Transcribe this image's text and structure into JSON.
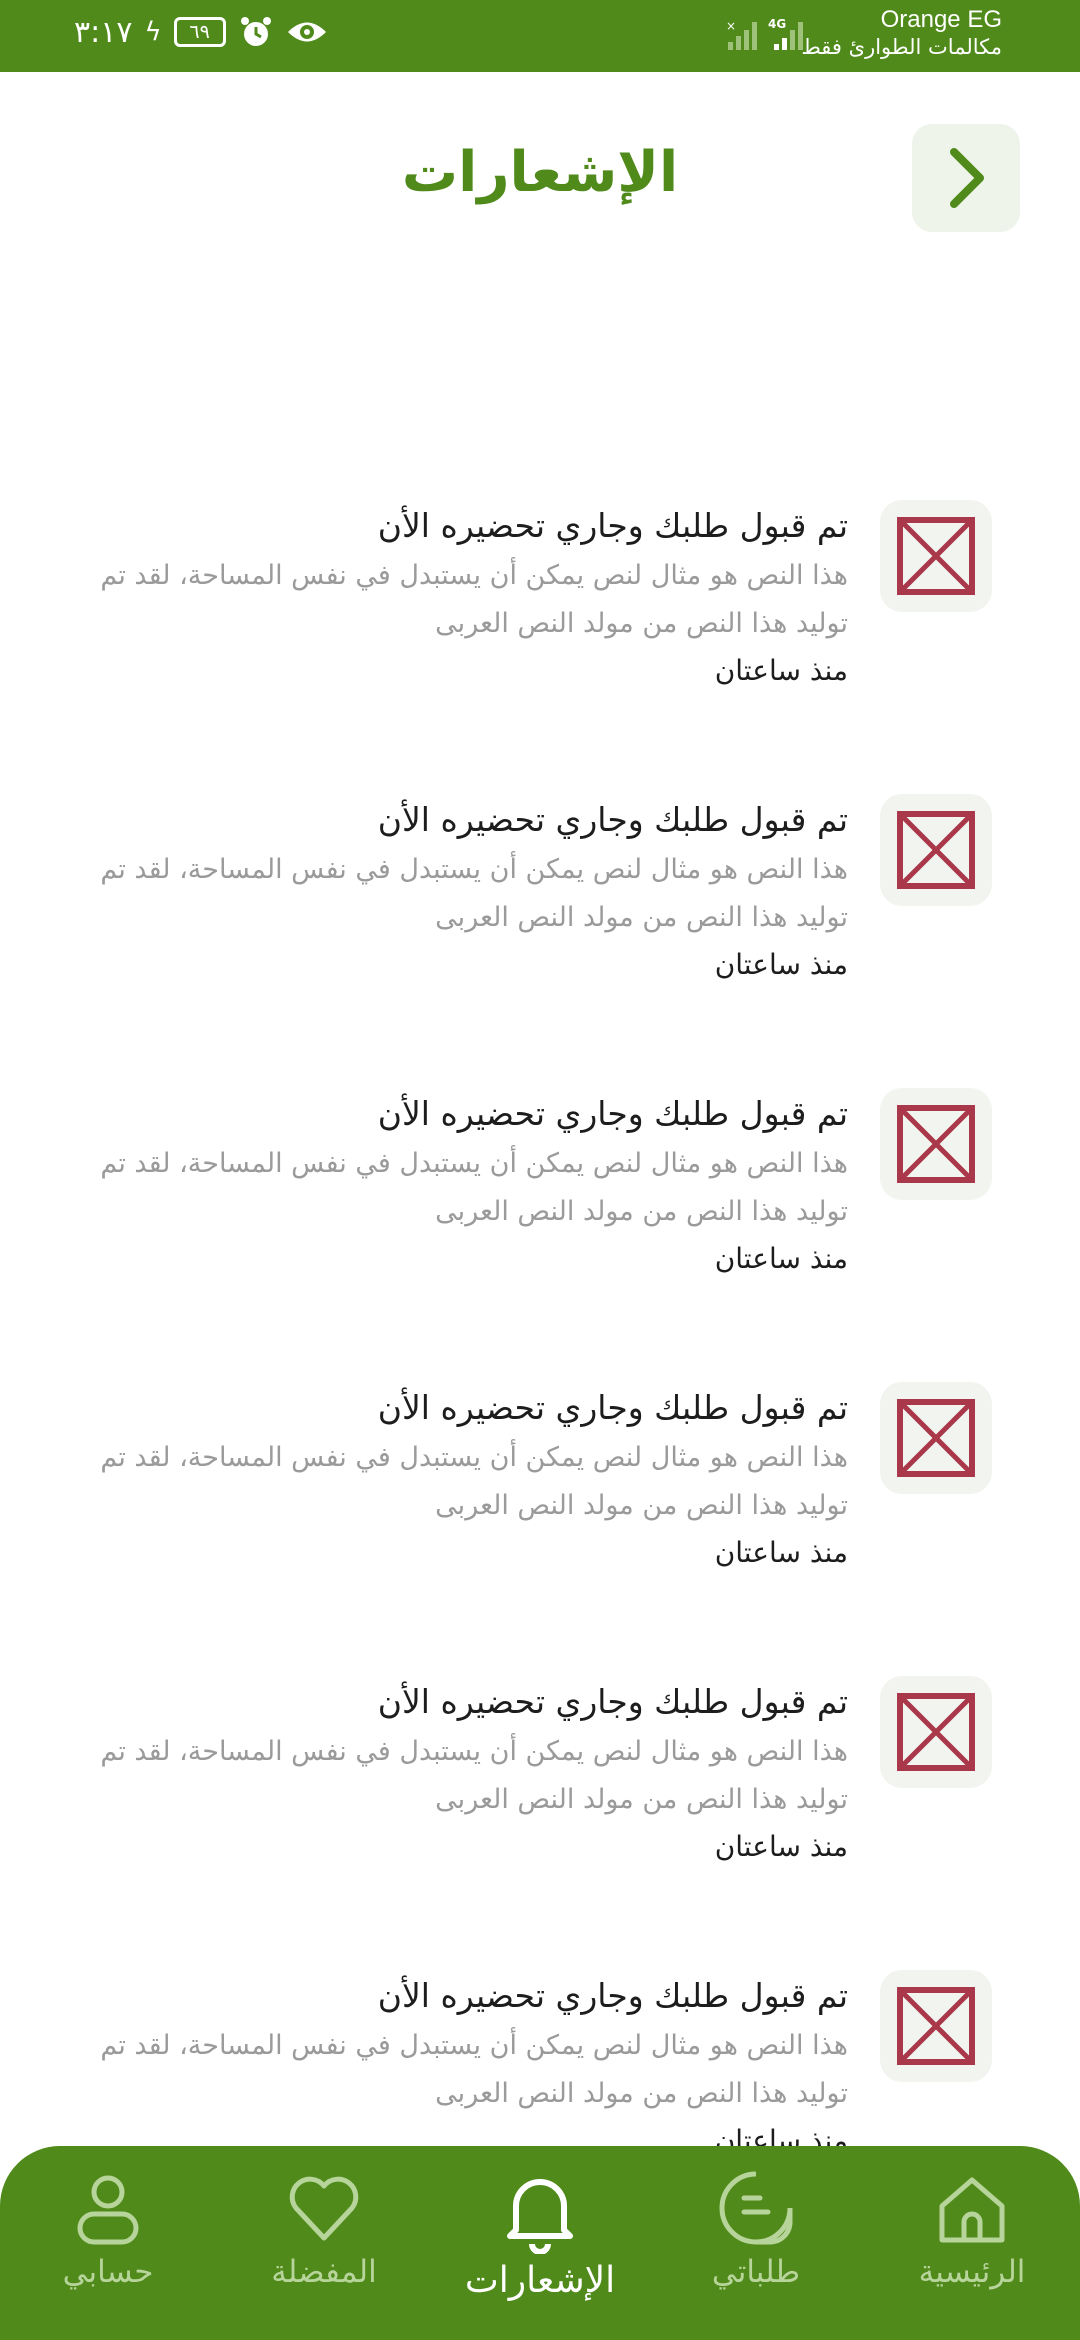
{
  "status_bar": {
    "time": "٣:١٧",
    "battery": "٦٩",
    "carrier": "Orange EG",
    "carrier_sub": "مكالمات الطوارئ فقط",
    "network": "4G"
  },
  "header": {
    "title": "الإشعارات",
    "back_icon": "chevron-right-icon"
  },
  "notifications": [
    {
      "title": "تم قبول طلبك وجاري تحضيره الأن",
      "body": "هذا النص هو مثال لنص يمكن أن يستبدل في نفس المساحة، لقد تم توليد هذا النص من مولد النص العربى",
      "time": "منذ ساعتان",
      "icon": "image-placeholder-icon"
    },
    {
      "title": "تم قبول طلبك وجاري تحضيره الأن",
      "body": "هذا النص هو مثال لنص يمكن أن يستبدل في نفس المساحة، لقد تم توليد هذا النص من مولد النص العربى",
      "time": "منذ ساعتان",
      "icon": "image-placeholder-icon"
    },
    {
      "title": "تم قبول طلبك وجاري تحضيره الأن",
      "body": "هذا النص هو مثال لنص يمكن أن يستبدل في نفس المساحة، لقد تم توليد هذا النص من مولد النص العربى",
      "time": "منذ ساعتان",
      "icon": "image-placeholder-icon"
    },
    {
      "title": "تم قبول طلبك وجاري تحضيره الأن",
      "body": "هذا النص هو مثال لنص يمكن أن يستبدل في نفس المساحة، لقد تم توليد هذا النص من مولد النص العربى",
      "time": "منذ ساعتان",
      "icon": "image-placeholder-icon"
    },
    {
      "title": "تم قبول طلبك وجاري تحضيره الأن",
      "body": "هذا النص هو مثال لنص يمكن أن يستبدل في نفس المساحة، لقد تم توليد هذا النص من مولد النص العربى",
      "time": "منذ ساعتان",
      "icon": "image-placeholder-icon"
    },
    {
      "title": "تم قبول طلبك وجاري تحضيره الأن",
      "body": "هذا النص هو مثال لنص يمكن أن يستبدل في نفس المساحة، لقد تم توليد هذا النص من مولد النص العربى",
      "time": "منذ ساعتان",
      "icon": "image-placeholder-icon"
    }
  ],
  "bottom_nav": {
    "items": [
      {
        "label": "حسابي",
        "icon": "user-icon",
        "active": false
      },
      {
        "label": "المفضلة",
        "icon": "heart-icon",
        "active": false
      },
      {
        "label": "الإشعارات",
        "icon": "bell-icon",
        "active": true
      },
      {
        "label": "طلباتي",
        "icon": "orders-icon",
        "active": false
      },
      {
        "label": "الرئيسية",
        "icon": "home-icon",
        "active": false
      }
    ]
  },
  "colors": {
    "brand_green": "#4f8a1a",
    "placeholder_red": "#a8384a",
    "muted_text": "#9a9a9a"
  }
}
